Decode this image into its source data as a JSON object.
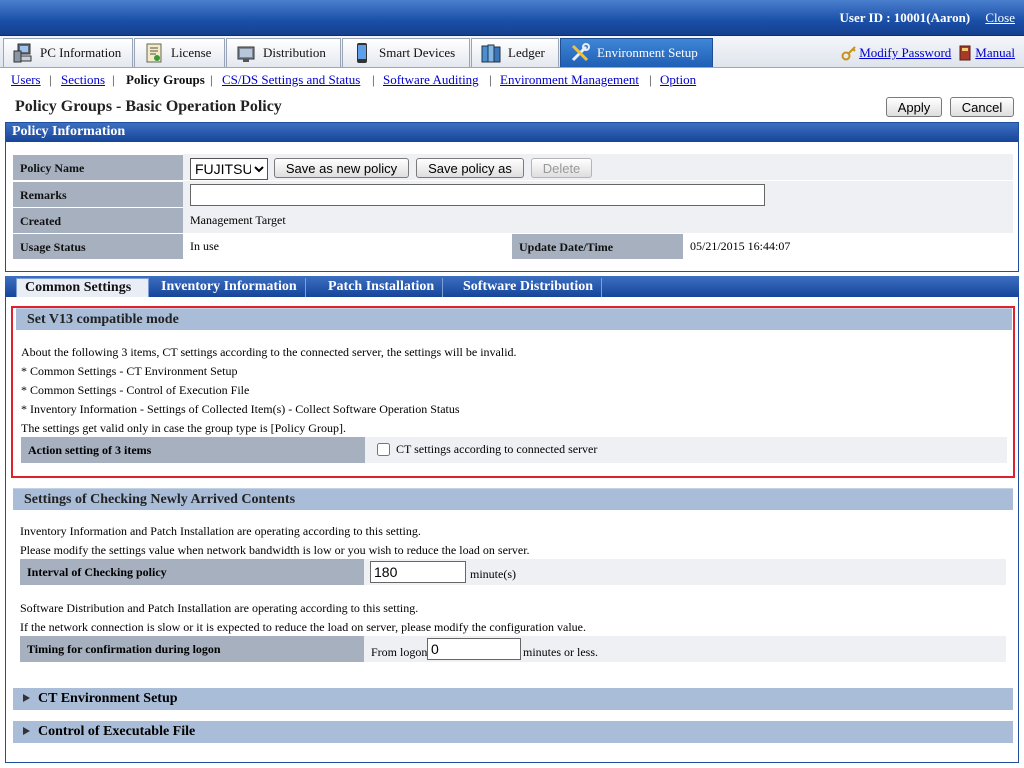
{
  "header": {
    "user_label": "User ID : 10001(Aaron)",
    "close_link": "Close"
  },
  "main_tabs": [
    {
      "label": "PC Information",
      "icon": "pc-icon"
    },
    {
      "label": "License",
      "icon": "license-icon"
    },
    {
      "label": "Distribution",
      "icon": "distribution-icon"
    },
    {
      "label": "Smart Devices",
      "icon": "smart-device-icon"
    },
    {
      "label": "Ledger",
      "icon": "ledger-icon"
    },
    {
      "label": "Environment Setup",
      "icon": "tools-icon",
      "active": true
    }
  ],
  "top_links": {
    "modify_password": "Modify Password",
    "manual": "Manual"
  },
  "subnav": {
    "items": [
      "Users",
      "Sections",
      "Policy Groups",
      "CS/DS Settings and Status",
      "Software Auditing",
      "Environment Management",
      "Option"
    ],
    "current": "Policy Groups"
  },
  "page": {
    "title": "Policy Groups - Basic Operation Policy",
    "apply_label": "Apply",
    "cancel_label": "Cancel"
  },
  "policy_info": {
    "heading": "Policy Information",
    "policy_name_label": "Policy Name",
    "policy_name_selected": "FUJITSU",
    "save_new_label": "Save as new policy",
    "save_as_label": "Save policy as",
    "delete_label": "Delete",
    "remarks_label": "Remarks",
    "remarks_value": "",
    "created_label": "Created",
    "created_value": "Management Target",
    "usage_label": "Usage Status",
    "usage_value": "In use",
    "update_label": "Update Date/Time",
    "update_value": "05/21/2015 16:44:07"
  },
  "sub_tabs": [
    "Common Settings",
    "Inventory Information",
    "Patch Installation",
    "Software Distribution"
  ],
  "v13": {
    "heading": "Set V13 compatible mode",
    "lines": [
      "About the following 3 items, CT settings according to the connected server, the settings will be invalid.",
      "* Common Settings - CT Environment Setup",
      "* Common Settings - Control of Execution File",
      "* Inventory Information - Settings of Collected Item(s) - Collect Software Operation Status",
      "The settings get valid only in case the group type is [Policy Group]."
    ],
    "action_label": "Action setting of 3 items",
    "checkbox_label": "CT settings according to connected server",
    "checked": false,
    "highlight_color": "#e0202a"
  },
  "checking": {
    "heading": "Settings of Checking Newly Arrived Contents",
    "lines1": [
      "Inventory Information and Patch Installation are operating according to this setting.",
      "Please modify the settings value when network bandwidth is low or you wish to reduce the load on server."
    ],
    "interval_label": "Interval of Checking policy",
    "interval_value": "180",
    "interval_unit": "minute(s)",
    "lines2": [
      "Software Distribution and Patch Installation are operating according to this setting.",
      "If the network connection is slow or it is expected to reduce the load on server, please modify the configuration value."
    ],
    "timing_label": "Timing for confirmation during logon",
    "timing_prefix": "From logon",
    "timing_value": "0",
    "timing_suffix": "minutes or less."
  },
  "collapsed": {
    "ct_env": "CT Environment Setup",
    "control_exec": "Control of Executable File"
  }
}
